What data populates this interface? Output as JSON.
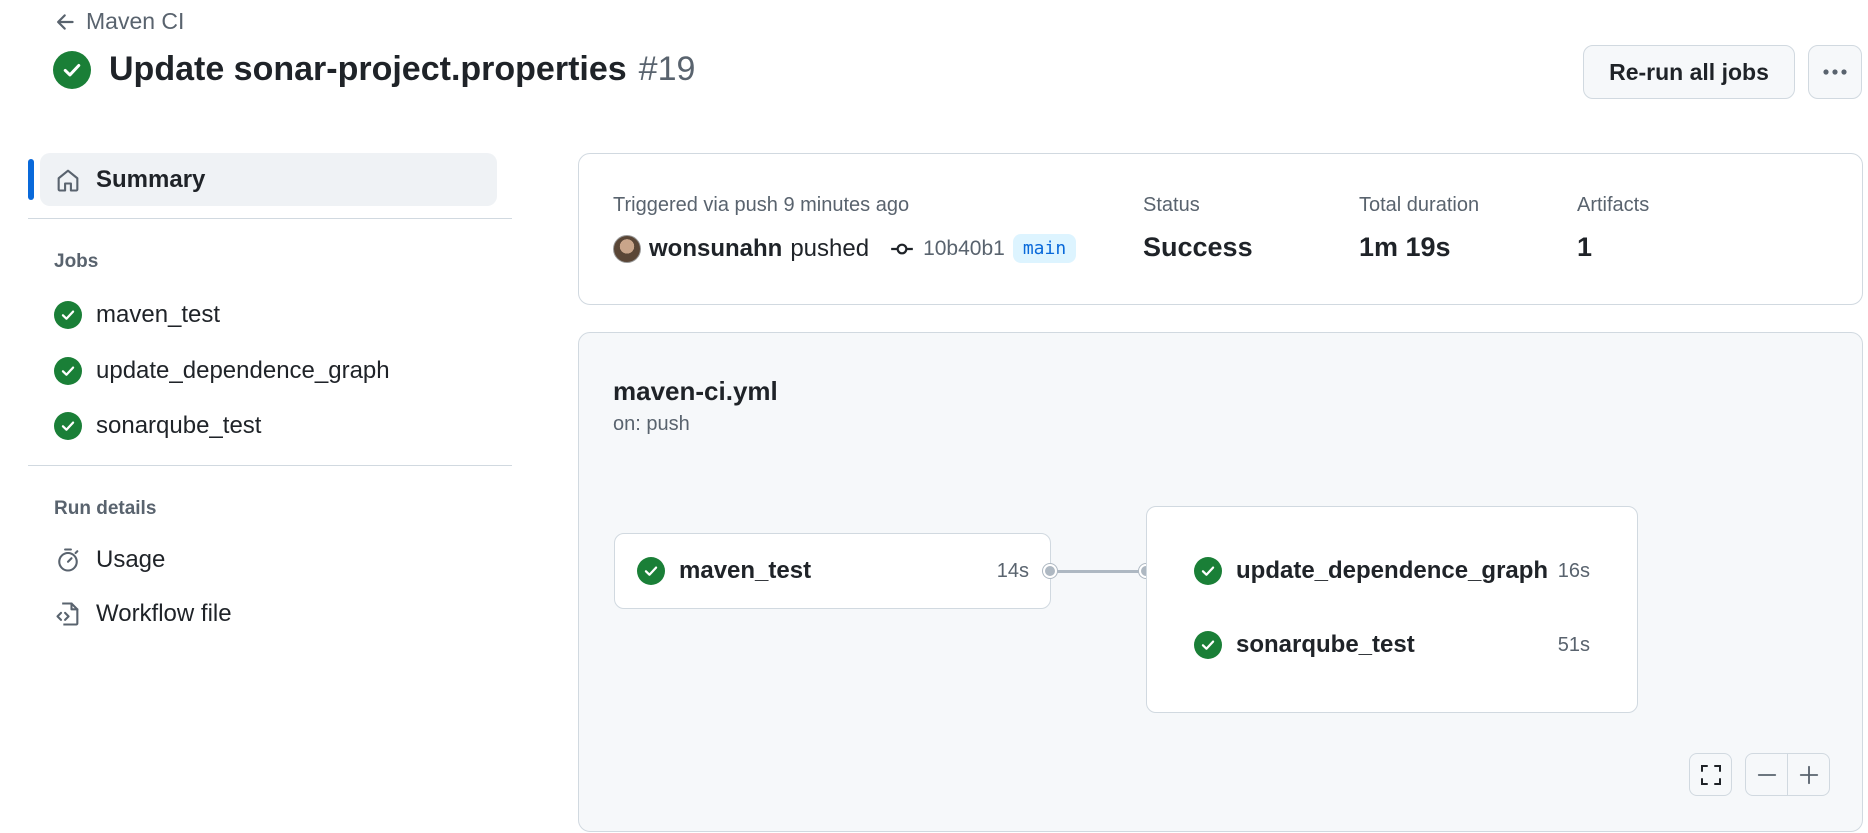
{
  "header": {
    "back_label": "Maven CI",
    "title": "Update sonar-project.properties",
    "run_number": "#19",
    "rerun_label": "Re-run all jobs",
    "more_label": "···"
  },
  "sidebar": {
    "summary_label": "Summary",
    "jobs_heading": "Jobs",
    "jobs": [
      "maven_test",
      "update_dependence_graph",
      "sonarqube_test"
    ],
    "run_details_heading": "Run details",
    "usage_label": "Usage",
    "workflow_file_label": "Workflow file"
  },
  "summary": {
    "trigger_text": "Triggered via push 9 minutes ago",
    "user": "wonsunahn",
    "action": "pushed",
    "commit": "10b40b1",
    "branch": "main",
    "status_label": "Status",
    "status_value": "Success",
    "duration_label": "Total duration",
    "duration_value": "1m 19s",
    "artifacts_label": "Artifacts",
    "artifacts_value": "1"
  },
  "graph": {
    "workflow_file": "maven-ci.yml",
    "trigger": "on: push",
    "jobs": [
      {
        "name": "maven_test",
        "duration": "14s"
      },
      {
        "name": "update_dependence_graph",
        "duration": "16s"
      },
      {
        "name": "sonarqube_test",
        "duration": "51s"
      }
    ]
  },
  "colors": {
    "success": "#1a7f37",
    "accent": "#0969da",
    "border": "#d1d9e0",
    "muted": "#59636e"
  }
}
